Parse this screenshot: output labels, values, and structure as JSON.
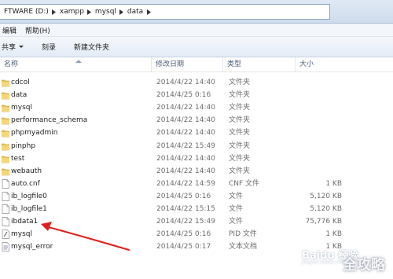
{
  "address_bar": {
    "crumbs": [
      "FTWARE (D:)",
      "xampp",
      "mysql",
      "data"
    ]
  },
  "menu": {
    "items": [
      "编辑",
      "帮助(H)"
    ]
  },
  "toolbar": {
    "share_label": "共享",
    "burn_label": "刻录",
    "new_folder_label": "新建文件夹"
  },
  "columns": {
    "name": "名称",
    "date_modified": "修改日期",
    "type": "类型",
    "size": "大小"
  },
  "files": [
    {
      "name": "cdcol",
      "date": "2014/4/22 14:40",
      "type": "文件夹",
      "size": "",
      "icon": "folder-icon"
    },
    {
      "name": "data",
      "date": "2014/4/25 0:16",
      "type": "文件夹",
      "size": "",
      "icon": "folder-icon"
    },
    {
      "name": "mysql",
      "date": "2014/4/22 14:40",
      "type": "文件夹",
      "size": "",
      "icon": "folder-icon"
    },
    {
      "name": "performance_schema",
      "date": "2014/4/22 14:40",
      "type": "文件夹",
      "size": "",
      "icon": "folder-icon"
    },
    {
      "name": "phpmyadmin",
      "date": "2014/4/22 14:40",
      "type": "文件夹",
      "size": "",
      "icon": "folder-icon"
    },
    {
      "name": "pinphp",
      "date": "2014/4/22 15:49",
      "type": "文件夹",
      "size": "",
      "icon": "folder-icon"
    },
    {
      "name": "test",
      "date": "2014/4/22 14:40",
      "type": "文件夹",
      "size": "",
      "icon": "folder-icon"
    },
    {
      "name": "webauth",
      "date": "2014/4/22 14:40",
      "type": "文件夹",
      "size": "",
      "icon": "folder-icon"
    },
    {
      "name": "auto.cnf",
      "date": "2014/4/22 14:59",
      "type": "CNF 文件",
      "size": "1 KB",
      "icon": "file-icon"
    },
    {
      "name": "ib_logfile0",
      "date": "2014/4/25 0:16",
      "type": "文件",
      "size": "5,120 KB",
      "icon": "file-icon"
    },
    {
      "name": "ib_logfile1",
      "date": "2014/4/22 15:15",
      "type": "文件",
      "size": "5,120 KB",
      "icon": "file-icon"
    },
    {
      "name": "ibdata1",
      "date": "2014/4/22 15:49",
      "type": "文件",
      "size": "75,776 KB",
      "icon": "file-icon"
    },
    {
      "name": "mysql",
      "date": "2014/4/25 0:16",
      "type": "PID 文件",
      "size": "1 KB",
      "icon": "pid-file-icon"
    },
    {
      "name": "mysql_error",
      "date": "2014/4/25 0:17",
      "type": "文本文档",
      "size": "1 KB",
      "icon": "text-file-icon"
    }
  ],
  "watermark": {
    "text": "全攻略",
    "logo_text": "Baidu 经验",
    "logo_sub": "jingyan.baidu.com"
  },
  "colors": {
    "annotation_arrow": "#e02020",
    "folder": "#e8c25a"
  }
}
